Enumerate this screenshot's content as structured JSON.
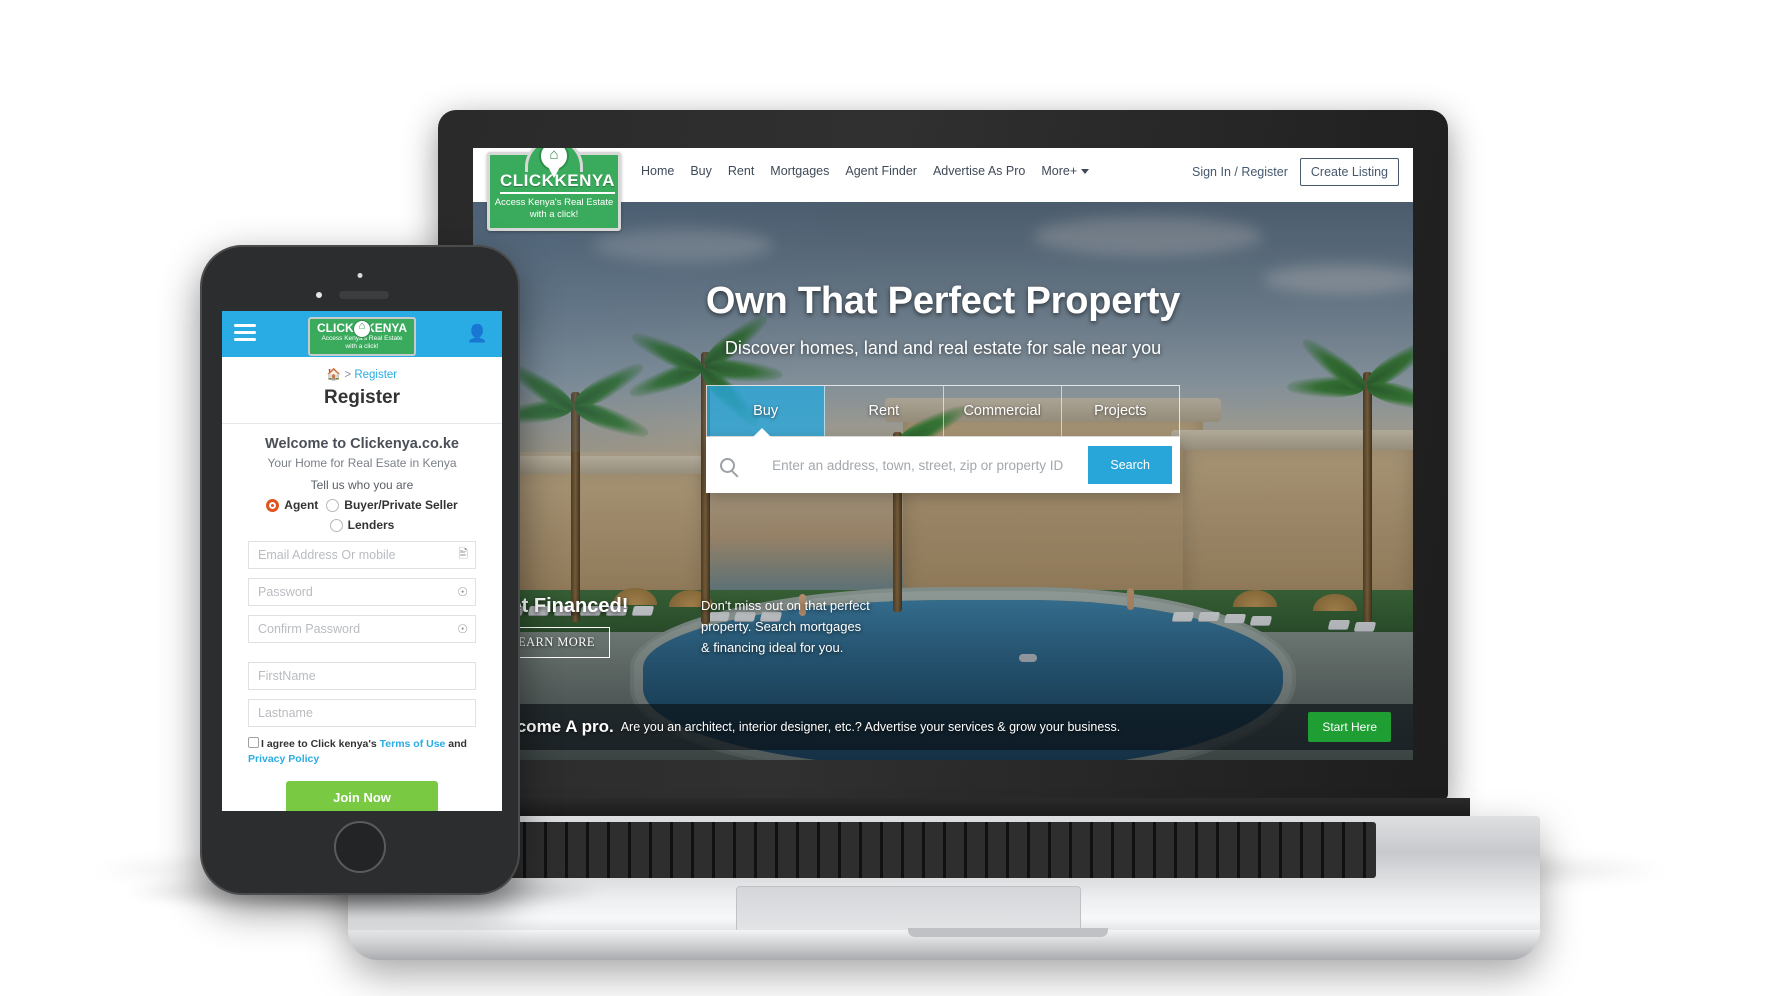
{
  "brand": {
    "logo_word_1": "CLICK",
    "logo_word_2": "KENYA",
    "logo_tagline_line1": "Access Kenya's Real Estate",
    "logo_tagline_line2": "with a click!",
    "green": "#3aab5c",
    "blue": "#29ace4",
    "accent_green": "#7ac943"
  },
  "laptop": {
    "nav": {
      "links": [
        {
          "label": "Home"
        },
        {
          "label": "Buy"
        },
        {
          "label": "Rent"
        },
        {
          "label": "Mortgages"
        },
        {
          "label": "Agent Finder"
        },
        {
          "label": "Advertise As Pro"
        },
        {
          "label": "More+"
        }
      ],
      "sign_in": "Sign In / Register",
      "create_listing": "Create Listing"
    },
    "hero": {
      "heading": "Own That Perfect Property",
      "subheading": "Discover homes, land and real estate for sale near you",
      "tabs": [
        {
          "label": "Buy",
          "active": true
        },
        {
          "label": "Rent",
          "active": false
        },
        {
          "label": "Commercial",
          "active": false
        },
        {
          "label": "Projects",
          "active": false
        }
      ],
      "search_placeholder": "Enter an address, town, street, zip or property ID",
      "search_button": "Search",
      "search_icon": "search-icon"
    },
    "promo": {
      "title": "Get Financed!",
      "button": "LEARN MORE",
      "text": "Don't miss out on that perfect property. Search mortgages & financing ideal for you."
    },
    "pro_bar": {
      "strong": "Become A pro.",
      "text": "Are you an architect, interior designer, etc.? Advertise your services & grow your business.",
      "button": "Start Here"
    }
  },
  "phone": {
    "header": {
      "menu_icon": "hamburger-menu-icon",
      "user_icon": "user-account-icon"
    },
    "breadcrumb": {
      "home_icon": "home-icon",
      "separator": ">",
      "current": "Register"
    },
    "page_title": "Register",
    "form": {
      "welcome": "Welcome to Clickenya.co.ke",
      "welcome_sub": "Your Home for Real Esate in Kenya",
      "tell_us": "Tell us who you are",
      "roles": [
        {
          "label": "Agent",
          "selected": true
        },
        {
          "label": "Buyer/Private Seller",
          "selected": false
        },
        {
          "label": "Lenders",
          "selected": false
        }
      ],
      "fields": [
        {
          "placeholder": "Email Address Or mobile",
          "icon": "contact-card-icon"
        },
        {
          "placeholder": "Password",
          "icon": "eye-toggle-icon"
        },
        {
          "placeholder": "Confirm Password",
          "icon": "eye-toggle-icon"
        },
        {
          "placeholder": "FirstName",
          "icon": ""
        },
        {
          "placeholder": "Lastname",
          "icon": ""
        }
      ],
      "terms_prefix": "I agree to Click kenya's ",
      "terms_link": "Terms of Use",
      "terms_and": " and ",
      "privacy_link": "Privacy Policy",
      "submit": "Join Now"
    }
  }
}
